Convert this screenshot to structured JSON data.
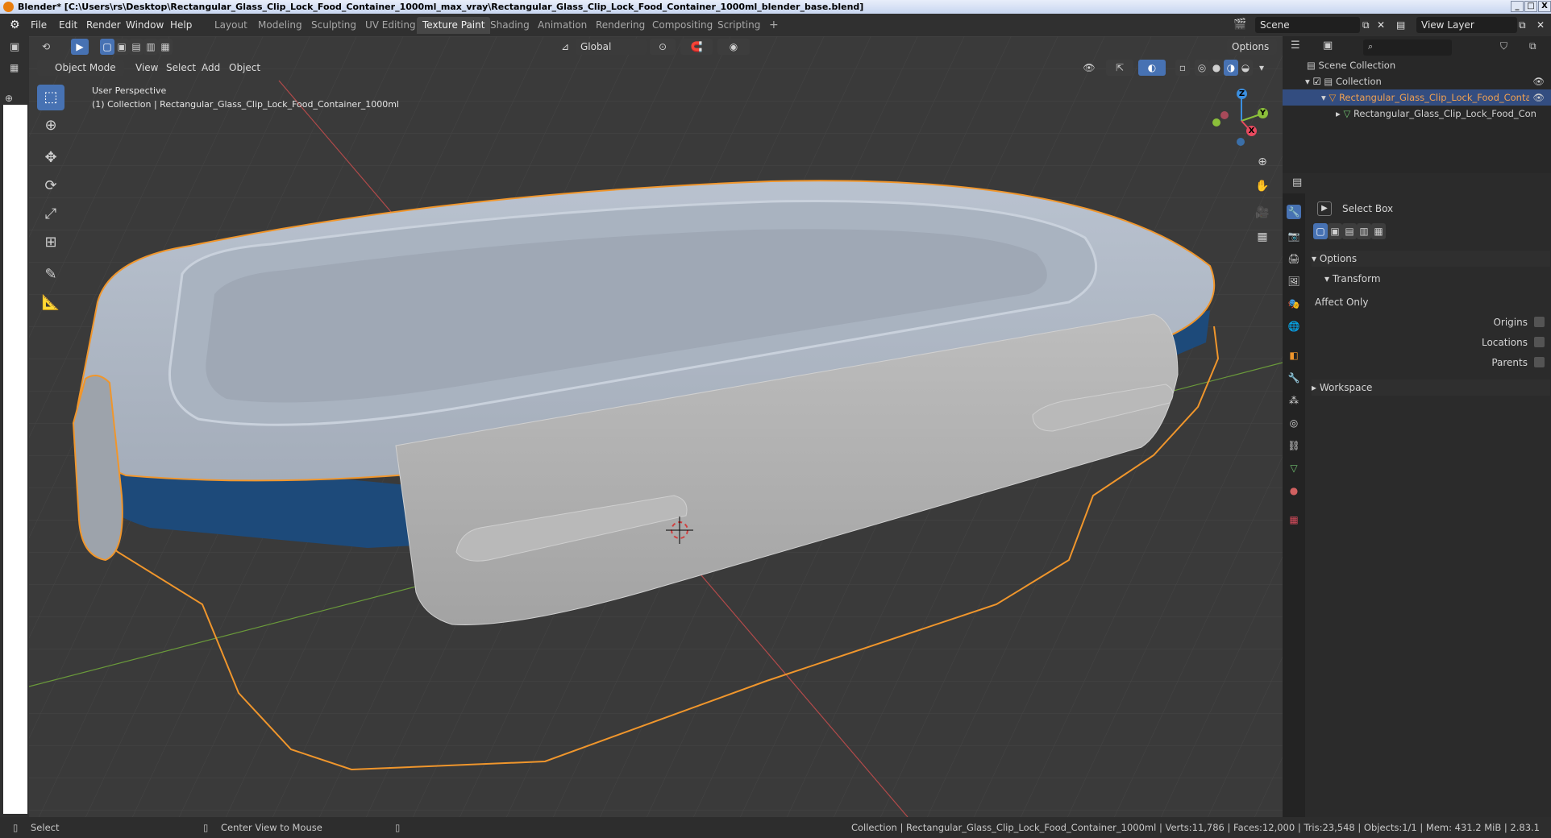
{
  "titlebar": {
    "title": "Blender* [C:\\Users\\rs\\Desktop\\Rectangular_Glass_Clip_Lock_Food_Container_1000ml_max_vray\\Rectangular_Glass_Clip_Lock_Food_Container_1000ml_blender_base.blend]",
    "minimize": "_",
    "maximize": "□",
    "close": "X"
  },
  "menu": [
    "File",
    "Edit",
    "Render",
    "Window",
    "Help"
  ],
  "workspaces": [
    {
      "label": "Layout",
      "active": false
    },
    {
      "label": "Modeling",
      "active": false
    },
    {
      "label": "Sculpting",
      "active": false
    },
    {
      "label": "UV Editing",
      "active": false
    },
    {
      "label": "Texture Paint",
      "active": true
    },
    {
      "label": "Shading",
      "active": false
    },
    {
      "label": "Animation",
      "active": false
    },
    {
      "label": "Rendering",
      "active": false
    },
    {
      "label": "Compositing",
      "active": false
    },
    {
      "label": "Scripting",
      "active": false
    }
  ],
  "add_workspace": "+",
  "scene": {
    "label": "Scene",
    "view_layer": "View Layer"
  },
  "viewport_header": {
    "mode": "Object Mode",
    "view": "View",
    "select": "Select",
    "add": "Add",
    "object": "Object",
    "transform_orientation": "Global",
    "options": "Options"
  },
  "viewport_overlay": {
    "perspective": "User Perspective",
    "collection_path": "(1) Collection | Rectangular_Glass_Clip_Lock_Food_Container_1000ml"
  },
  "gizmo": {
    "z": "Z",
    "y": "Y",
    "x": "X"
  },
  "outliner": {
    "search_placeholder": "",
    "scene_collection": "Scene Collection",
    "collection": "Collection",
    "object": "Rectangular_Glass_Clip_Lock_Food_Contain",
    "mesh": "Rectangular_Glass_Clip_Lock_Food_Con"
  },
  "properties": {
    "tool_name": "Select Box",
    "options_panel": "Options",
    "transform_panel": "Transform",
    "affect_only": "Affect Only",
    "origins": "Origins",
    "locations": "Locations",
    "parents": "Parents",
    "workspace_panel": "Workspace"
  },
  "statusbar": {
    "select": "Select",
    "center_view": "Center View to Mouse",
    "stats": "Collection | Rectangular_Glass_Clip_Lock_Food_Container_1000ml | Verts:11,786 | Faces:12,000 | Tris:23,548 | Objects:1/1 | Mem: 431.2 MiB | 2.83.1"
  },
  "colors": {
    "accent": "#4772b3",
    "selection_outline": "#f0962c",
    "grid_x_axis": "#b24a4a",
    "grid_y_axis": "#6a9a3a",
    "gizmo_x": "#e84a5f",
    "gizmo_y": "#8bbf3a",
    "gizmo_z": "#3b8fe0"
  }
}
